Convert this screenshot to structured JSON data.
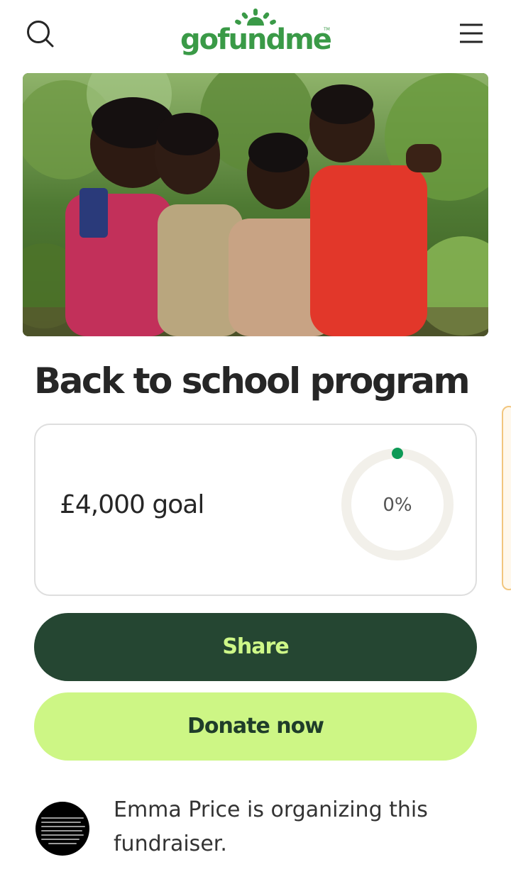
{
  "header": {
    "search_icon": "search-icon",
    "menu_icon": "hamburger-menu-icon",
    "logo_text": "gofundme",
    "logo_tm": "TM",
    "brand_color": "#3a9a47"
  },
  "hero": {
    "image_subject": "photo-four-children-outdoors"
  },
  "campaign": {
    "title": "Back to school program"
  },
  "goal": {
    "text": "£4,000 goal",
    "progress_label": "0%",
    "progress_fraction": 0,
    "indicator_color": "#0d9a56"
  },
  "actions": {
    "share_label": "Share",
    "donate_label": "Donate now",
    "share_bg": "#254632",
    "donate_bg": "#cdf685"
  },
  "organizer": {
    "text": "Emma Price is organizing this fundraiser."
  }
}
